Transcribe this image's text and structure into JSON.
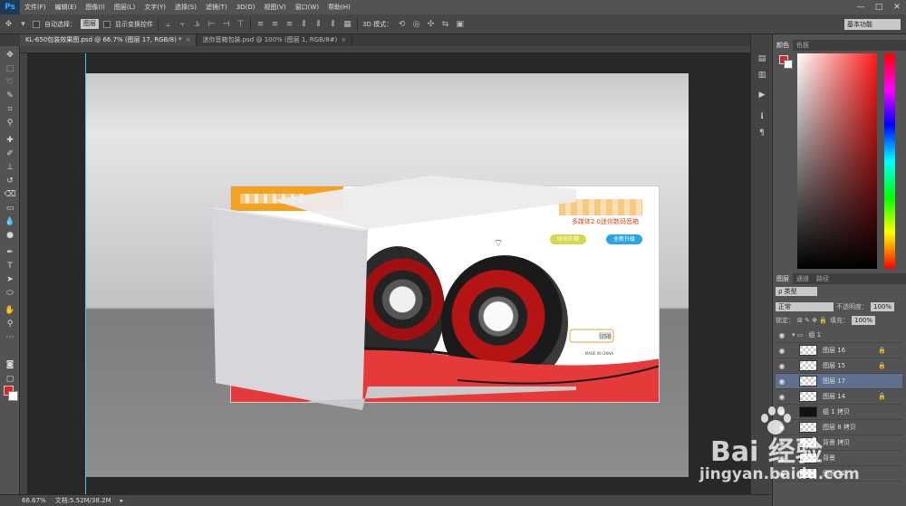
{
  "app": {
    "logo": "Ps"
  },
  "menu": [
    "文件(F)",
    "编辑(E)",
    "图像(I)",
    "图层(L)",
    "文字(Y)",
    "选择(S)",
    "滤镜(T)",
    "3D(D)",
    "视图(V)",
    "窗口(W)",
    "帮助(H)"
  ],
  "window_controls": [
    "—",
    "□",
    "✕"
  ],
  "options": {
    "auto_select_label": "自动选择：",
    "auto_select_value": "图层",
    "transform_label": "显示变换控件",
    "mode_3d_label": "3D 模式：",
    "workspace": "基本功能"
  },
  "tabs": [
    {
      "label": "KL-650包装效果图.psd @ 66.7% (图层 17, RGB/8) *",
      "close": "×"
    },
    {
      "label": "迷你音箱包装.psd @ 100% (图层 1, RGB/8#)",
      "close": "×"
    }
  ],
  "banner": {
    "subtitle": "多媒体2.0迷你数码音箱",
    "btn1": "时尚外观",
    "btn2": "全新升级",
    "left_text1": "时尚",
    "left_text2": "月",
    "usb_text": "USB",
    "made_in": "MADE IN CHINA"
  },
  "color_panel": {
    "tabs": [
      "颜色",
      "色板"
    ]
  },
  "layers_panel": {
    "tabs": [
      "图层",
      "通道",
      "路径"
    ],
    "filter": "ρ 类型",
    "blend_mode": "正常",
    "opacity_label": "不透明度：",
    "opacity_value": "100%",
    "lock_label": "锁定：",
    "fill_label": "填充：",
    "fill_value": "100%",
    "layers": [
      {
        "name": "组 1",
        "type": "group"
      },
      {
        "name": "图层 16",
        "type": "layer"
      },
      {
        "name": "图层 15",
        "type": "layer"
      },
      {
        "name": "图层 17",
        "type": "layer",
        "selected": true
      },
      {
        "name": "图层 14",
        "type": "layer"
      },
      {
        "name": "组 1 拷贝",
        "type": "group"
      },
      {
        "name": "图层 8 拷贝",
        "type": "layer"
      },
      {
        "name": "背景 拷贝",
        "type": "layer"
      },
      {
        "name": "背景",
        "type": "layer"
      },
      {
        "name": "图层 11",
        "type": "layer"
      }
    ]
  },
  "status": {
    "zoom": "66.67%",
    "doc_info": "文档:5.52M/38.2M"
  },
  "watermark": {
    "brand": "Bai 经验",
    "url": "jingyan.baidu.com"
  },
  "colors": {
    "foreground": "#e22222",
    "background": "#ffffff",
    "accent": "#f4a021"
  }
}
